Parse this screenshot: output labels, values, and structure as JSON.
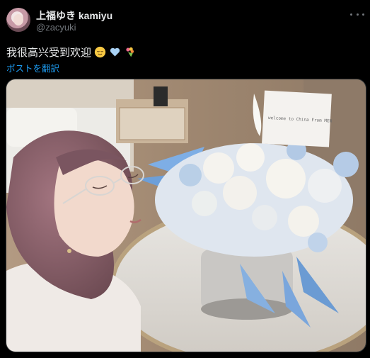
{
  "author": {
    "display_name": "上福ゆき kamiyu",
    "handle": "@zacyuki"
  },
  "tweet": {
    "text": "我很高兴受到欢迎",
    "translate_label": "ポストを翻訳"
  },
  "media": {
    "card_text": "welcome to China From MEN"
  },
  "icons": {
    "more": "more-options-icon",
    "emoji_1": "relieved-face-emoji",
    "emoji_2": "light-blue-heart-emoji",
    "emoji_3": "bouquet-emoji"
  },
  "colors": {
    "background": "#000000",
    "text": "#e7e9ea",
    "muted": "#71767b",
    "link": "#1d9bf0"
  }
}
